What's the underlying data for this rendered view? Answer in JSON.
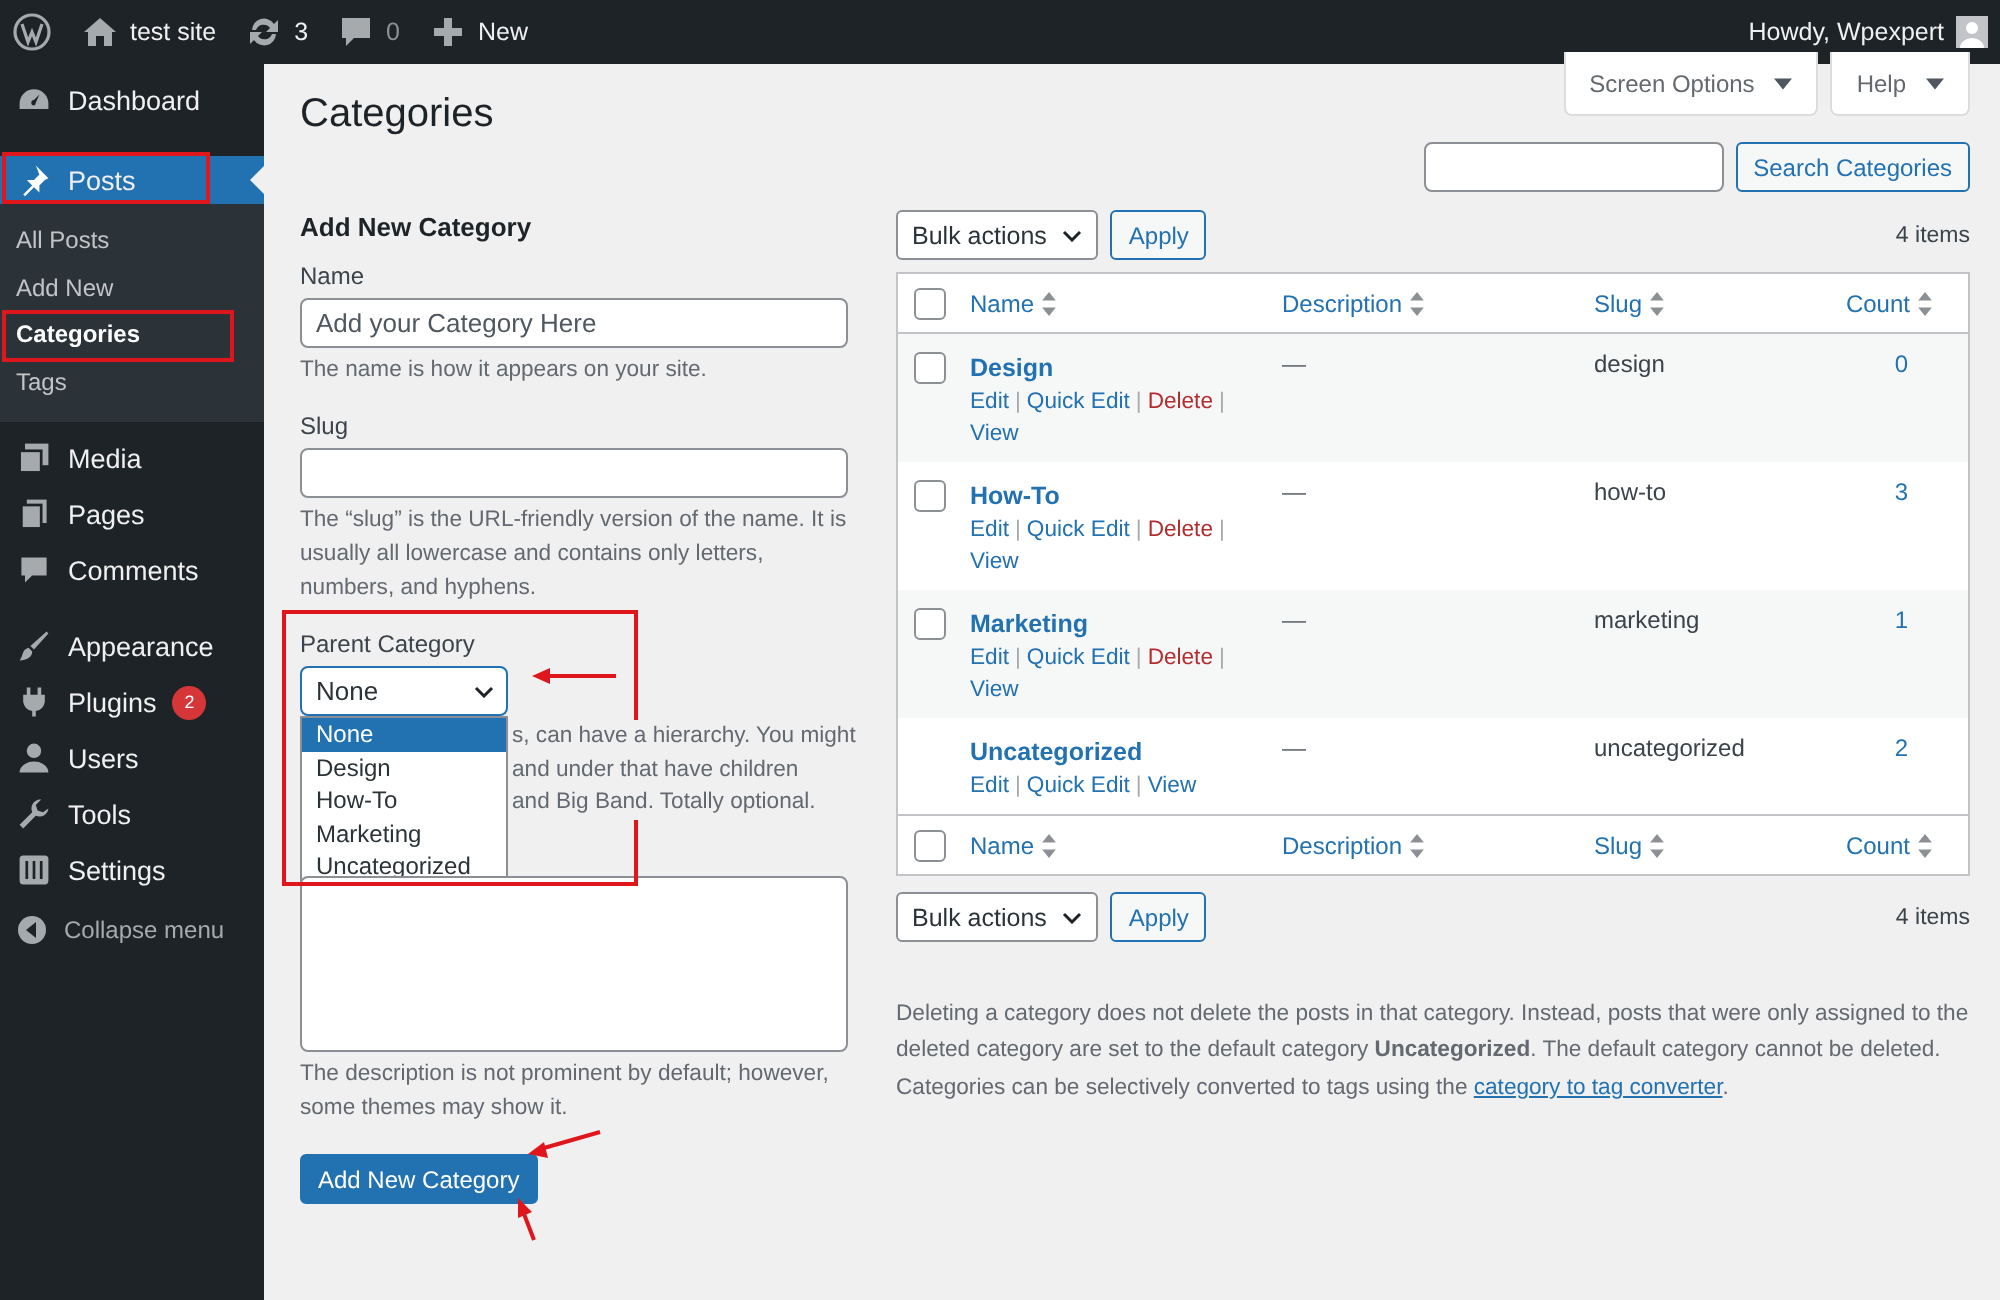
{
  "admin_bar": {
    "site": "test site",
    "updates": "3",
    "comments": "0",
    "new": "New",
    "greeting": "Howdy, Wpexpert"
  },
  "sidebar": {
    "items": [
      {
        "label": "Dashboard",
        "selected": false
      },
      {
        "label": "Posts",
        "selected": true,
        "children": [
          {
            "label": "All Posts",
            "selected": false
          },
          {
            "label": "Add New",
            "selected": false
          },
          {
            "label": "Categories",
            "selected": true
          },
          {
            "label": "Tags",
            "selected": false
          }
        ]
      },
      {
        "label": "Media",
        "selected": false
      },
      {
        "label": "Pages",
        "selected": false
      },
      {
        "label": "Comments",
        "selected": false
      },
      {
        "label": "Appearance",
        "selected": false
      },
      {
        "label": "Plugins",
        "selected": false,
        "badge": "2"
      },
      {
        "label": "Users",
        "selected": false
      },
      {
        "label": "Tools",
        "selected": false
      },
      {
        "label": "Settings",
        "selected": false
      }
    ],
    "collapse": "Collapse menu"
  },
  "top_buttons": [
    "Screen Options",
    "Help"
  ],
  "page_title": "Categories",
  "search": {
    "button": "Search Categories"
  },
  "form": {
    "title": "Add New Category",
    "name": {
      "label": "Name",
      "value": "Add your Category Here",
      "hint": "The name is how it appears on your site."
    },
    "slug": {
      "label": "Slug",
      "hint": "The “slug” is the URL-friendly version of the name. It is usually all lowercase and contains only letters, numbers, and hyphens."
    },
    "parent": {
      "label": "Parent Category",
      "value": "None",
      "expanded": true,
      "options": [
        {
          "label": "None",
          "selected": true
        },
        {
          "label": "Design",
          "selected": false
        },
        {
          "label": "How-To",
          "selected": false
        },
        {
          "label": "Marketing",
          "selected": false
        },
        {
          "label": "Uncategorized",
          "selected": false
        }
      ],
      "hint_lines": [
        "s, can have a hierarchy. You might",
        "and under that have children",
        "and Big Band. Totally optional."
      ]
    },
    "description": {
      "hint": "The description is not prominent by default; however, some themes may show it."
    },
    "submit": "Add New Category"
  },
  "table": {
    "top_bar": {
      "bulk": "Bulk actions",
      "apply": "Apply",
      "count": "4 items"
    },
    "head_checked": false,
    "columns": [
      "Name",
      "Description",
      "Slug",
      "Count"
    ],
    "rows": [
      {
        "name": "Design",
        "checked": false,
        "description": "—",
        "slug": "design",
        "count": "0",
        "action_lines": [
          [
            {
              "label": "Edit",
              "kind": "link"
            },
            {
              "label": "|",
              "kind": "separator"
            },
            {
              "label": "Quick Edit",
              "kind": "link"
            },
            {
              "label": "|",
              "kind": "separator"
            },
            {
              "label": "Delete",
              "kind": "delete"
            },
            {
              "label": "|",
              "kind": "separator"
            }
          ],
          [
            {
              "label": "View",
              "kind": "link"
            }
          ]
        ]
      },
      {
        "name": "How-To",
        "checked": false,
        "description": "—",
        "slug": "how-to",
        "count": "3",
        "action_lines": [
          [
            {
              "label": "Edit",
              "kind": "link"
            },
            {
              "label": "|",
              "kind": "separator"
            },
            {
              "label": "Quick Edit",
              "kind": "link"
            },
            {
              "label": "|",
              "kind": "separator"
            },
            {
              "label": "Delete",
              "kind": "delete"
            },
            {
              "label": "|",
              "kind": "separator"
            }
          ],
          [
            {
              "label": "View",
              "kind": "link"
            }
          ]
        ]
      },
      {
        "name": "Marketing",
        "checked": false,
        "description": "—",
        "slug": "marketing",
        "count": "1",
        "action_lines": [
          [
            {
              "label": "Edit",
              "kind": "link"
            },
            {
              "label": "|",
              "kind": "separator"
            },
            {
              "label": "Quick Edit",
              "kind": "link"
            },
            {
              "label": "|",
              "kind": "separator"
            },
            {
              "label": "Delete",
              "kind": "delete"
            },
            {
              "label": "|",
              "kind": "separator"
            }
          ],
          [
            {
              "label": "View",
              "kind": "link"
            }
          ]
        ]
      },
      {
        "name": "Uncategorized",
        "description": "—",
        "slug": "uncategorized",
        "count": "2",
        "action_lines": [
          [
            {
              "label": "Edit",
              "kind": "link"
            },
            {
              "label": "|",
              "kind": "separator"
            },
            {
              "label": "Quick Edit",
              "kind": "link"
            },
            {
              "label": "|",
              "kind": "separator"
            },
            {
              "label": "View",
              "kind": "link"
            }
          ]
        ]
      }
    ],
    "foot_checked": false,
    "footer_columns": [
      "Name",
      "Description",
      "Slug",
      "Count"
    ],
    "bottom_bar": {
      "bulk": "Bulk actions",
      "apply": "Apply",
      "count": "4 items"
    }
  },
  "notes": {
    "delete_note": "Deleting a category does not delete the posts in that category. Instead, posts that were only assigned to the deleted category are set to the default category **Uncategorized**. The default category cannot be deleted.",
    "convert_before": "Categories can be selectively converted to tags using the",
    "convert_link": "category to tag converter",
    "convert_after": "."
  }
}
